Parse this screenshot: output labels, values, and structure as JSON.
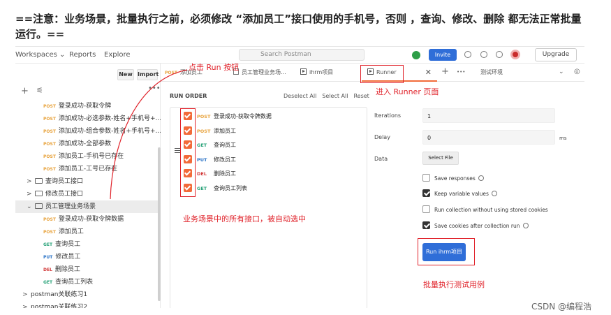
{
  "note": "==注意：业务场景，批量执行之前，必须修改 “添加员工”接口使用的手机号，否则 ，查询、修改、删除 都无法正常批量运行。==",
  "topbar": {
    "workspaces": "Workspaces ⌄",
    "reports": "Reports",
    "explore": "Explore",
    "search_placeholder": "Search Postman",
    "invite": "Invite",
    "upgrade": "Upgrade"
  },
  "sidebar": {
    "new_label": "New",
    "import_label": "Import",
    "items": [
      {
        "method": "POST",
        "text": "登录成功-获取令牌"
      },
      {
        "method": "POST",
        "text": "添加成功-必选参数-姓名+手机号+..."
      },
      {
        "method": "POST",
        "text": "添加成功-组合参数-姓名+手机号+..."
      },
      {
        "method": "POST",
        "text": "添加成功-全部参数"
      },
      {
        "method": "POST",
        "text": "添加员工-手机号已存在"
      },
      {
        "method": "POST",
        "text": "添加员工-工号已存在"
      },
      {
        "folder": true,
        "chev": ">",
        "text": "查询员工接口"
      },
      {
        "folder": true,
        "chev": ">",
        "text": "修改员工接口"
      },
      {
        "folder": true,
        "chev": "⌄",
        "text": "员工管理业务场景",
        "selected": true
      },
      {
        "method": "POST",
        "text": "登录成功-获取令牌数据"
      },
      {
        "method": "POST",
        "text": "添加员工"
      },
      {
        "method": "GET",
        "text": "查询员工"
      },
      {
        "method": "PUT",
        "text": "修改员工"
      },
      {
        "method": "DEL",
        "text": "删除员工"
      },
      {
        "method": "GET",
        "text": "查询员工列表"
      },
      {
        "collection": true,
        "chev": ">",
        "text": "postman关联练习1"
      },
      {
        "collection": true,
        "chev": ">",
        "text": "postman关联练习2"
      }
    ]
  },
  "tabs": [
    {
      "method": "POST",
      "text": "添加员工"
    },
    {
      "text": "员工管理业务场..."
    },
    {
      "text": "ihrm项目"
    },
    {
      "text": "Runner",
      "active": true
    },
    {
      "text": "测试环境"
    }
  ],
  "run_order": {
    "title": "RUN ORDER",
    "deselect_all": "Deselect All",
    "select_all": "Select All",
    "reset": "Reset",
    "items": [
      {
        "method": "POST",
        "text": "登录成功-获取令牌数据"
      },
      {
        "method": "POST",
        "text": "添加员工"
      },
      {
        "method": "GET",
        "text": "查询员工"
      },
      {
        "method": "PUT",
        "text": "修改员工"
      },
      {
        "method": "DEL",
        "text": "删除员工"
      },
      {
        "method": "GET",
        "text": "查询员工列表"
      }
    ]
  },
  "settings": {
    "iterations_label": "Iterations",
    "iterations_value": "1",
    "delay_label": "Delay",
    "delay_value": "0",
    "delay_unit": "ms",
    "data_label": "Data",
    "select_file": "Select File",
    "save_responses": "Save responses",
    "keep_variable_values": "Keep variable values",
    "run_without_cookies": "Run collection without using stored cookies",
    "save_cookies": "Save cookies after collection run",
    "run_button": "Run ihrm项目"
  },
  "annotations": {
    "click_run": "点击 Run 按钮",
    "enter_runner": "进入 Runner 页面",
    "auto_selected": "业务场景中的所有接口，被自动选中",
    "batch_run": "批量执行测试用例"
  },
  "watermark": "CSDN @编程浩",
  "colors": {
    "accent": "#f26b3a",
    "primary": "#2f6ed8",
    "annotation": "#e0222a"
  }
}
